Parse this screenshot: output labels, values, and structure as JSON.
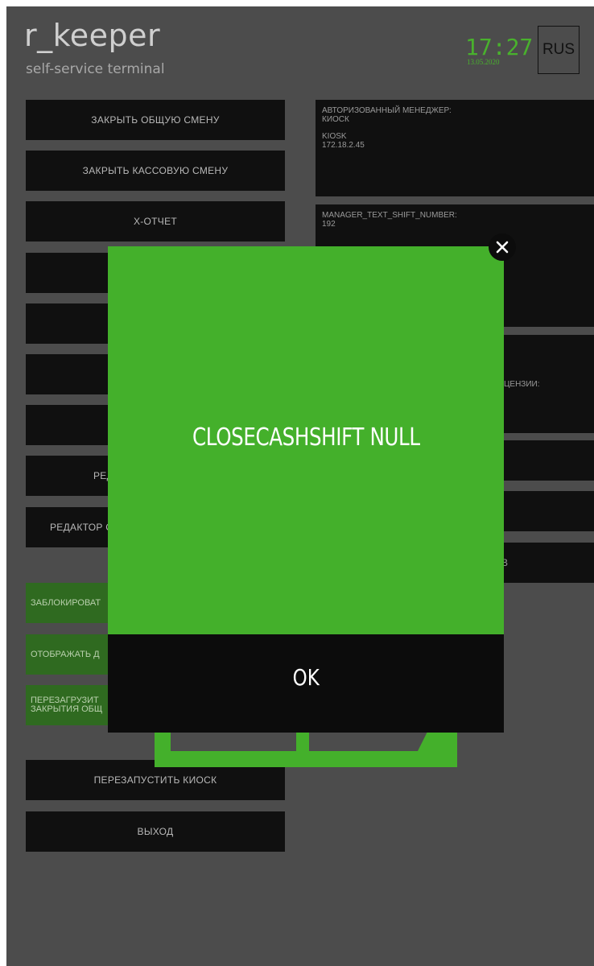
{
  "header": {
    "logo_title": "r_keeper",
    "logo_subtitle": "self-service terminal",
    "time": "17:27",
    "date": "13.05.2020",
    "language": "RUS"
  },
  "left_menu": {
    "close_general_shift": "ЗАКРЫТЬ ОБЩУЮ СМЕНУ",
    "close_cash_shift": "ЗАКРЫТЬ КАССОВУЮ СМЕНУ",
    "x_report": "Х-ОТЧЕТ",
    "editor_partial": "РЕД",
    "editor_s_partial": "РЕДАКТОР С",
    "block_partial": "ЗАБЛОКИРОВАТ",
    "display_partial": "ОТОБРАЖАТЬ Д",
    "reboot_partial_line1": "ПЕРЕЗАГРУЗИТ",
    "reboot_partial_line2": "ЗАКРЫТИЯ ОБЩ",
    "restart_kiosk": "ПЕРЕЗАПУСТИТЬ КИОСК",
    "exit": "ВЫХОД"
  },
  "right_panels": {
    "manager_label": "АВТОРИЗОВАННЫЙ МЕНЕДЖЕР:",
    "manager_value": "КИОСК",
    "kiosk_name": "KIOSK",
    "kiosk_ip": "172.18.2.45",
    "shift_label": "MANAGER_TEXT_SHIFT_NUMBER:",
    "shift_value": "192",
    "license_partial": "ЦЕНЗИИ:",
    "button_partial_b": "В"
  },
  "dialog": {
    "message": "CLOSECASHSHIFT NULL",
    "ok_label": "OK"
  },
  "colors": {
    "background": "#4c4c4c",
    "accent_green": "#44b02b",
    "panel_black": "#101010",
    "dark_green": "#2f6a20"
  }
}
